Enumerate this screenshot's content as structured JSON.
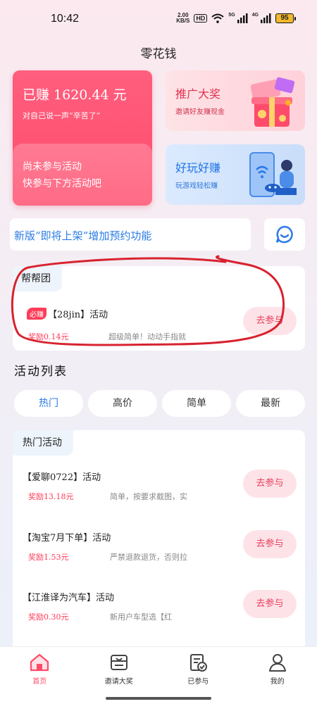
{
  "status_bar": {
    "time": "10:42",
    "net_speed_top": "2.00",
    "net_speed_bottom": "KB/S",
    "hd": "HD",
    "sig1": "5G",
    "sig2": "4G",
    "battery": "95"
  },
  "app": {
    "title": "零花钱"
  },
  "earn_card": {
    "amount": "已赚 1620.44 元",
    "subtitle": "对自己说一声“辛苦了”",
    "line1": "尚未参与活动",
    "line2": "快参与下方活动吧"
  },
  "promo_card": {
    "title": "推广大奖",
    "subtitle": "邀请好友赚现金"
  },
  "game_card": {
    "title": "好玩好赚",
    "subtitle": "玩游戏轻松赚"
  },
  "notice": {
    "text": "新版“即将上架”增加预约功能"
  },
  "help_group": {
    "tab": "帮帮团",
    "badge": "必赚",
    "name": "【28jin】活动",
    "reward": "奖励0.14元",
    "desc": "超级简单！动动手指就",
    "button": "去参与"
  },
  "activity_list": {
    "title": "活动列表",
    "tabs": [
      "热门",
      "高价",
      "简单",
      "最新"
    ],
    "active_tab": "热门",
    "section_tab": "热门活动",
    "items": [
      {
        "name": "【爱聊0722】活动",
        "reward": "奖励13.18元",
        "desc": "简单，按要求截图，实",
        "button": "去参与"
      },
      {
        "name": "【淘宝7月下单】活动",
        "reward": "奖励1.53元",
        "desc": "严禁退款退货，否则拉",
        "button": "去参与"
      },
      {
        "name": "【江淮译为汽车】活动",
        "reward": "奖励0.30元",
        "desc": "新用户车型选【红",
        "button": "去参与"
      }
    ]
  },
  "bottom_nav": [
    {
      "label": "首页",
      "icon": "home-icon",
      "active": true
    },
    {
      "label": "邀请大奖",
      "icon": "gift-box-icon",
      "active": false
    },
    {
      "label": "已参与",
      "icon": "checklist-icon",
      "active": false
    },
    {
      "label": "我的",
      "icon": "user-icon",
      "active": false
    }
  ],
  "colors": {
    "accent_red": "#ff4b6b",
    "accent_blue": "#2a7be6",
    "annotation_red": "#d8222f"
  }
}
